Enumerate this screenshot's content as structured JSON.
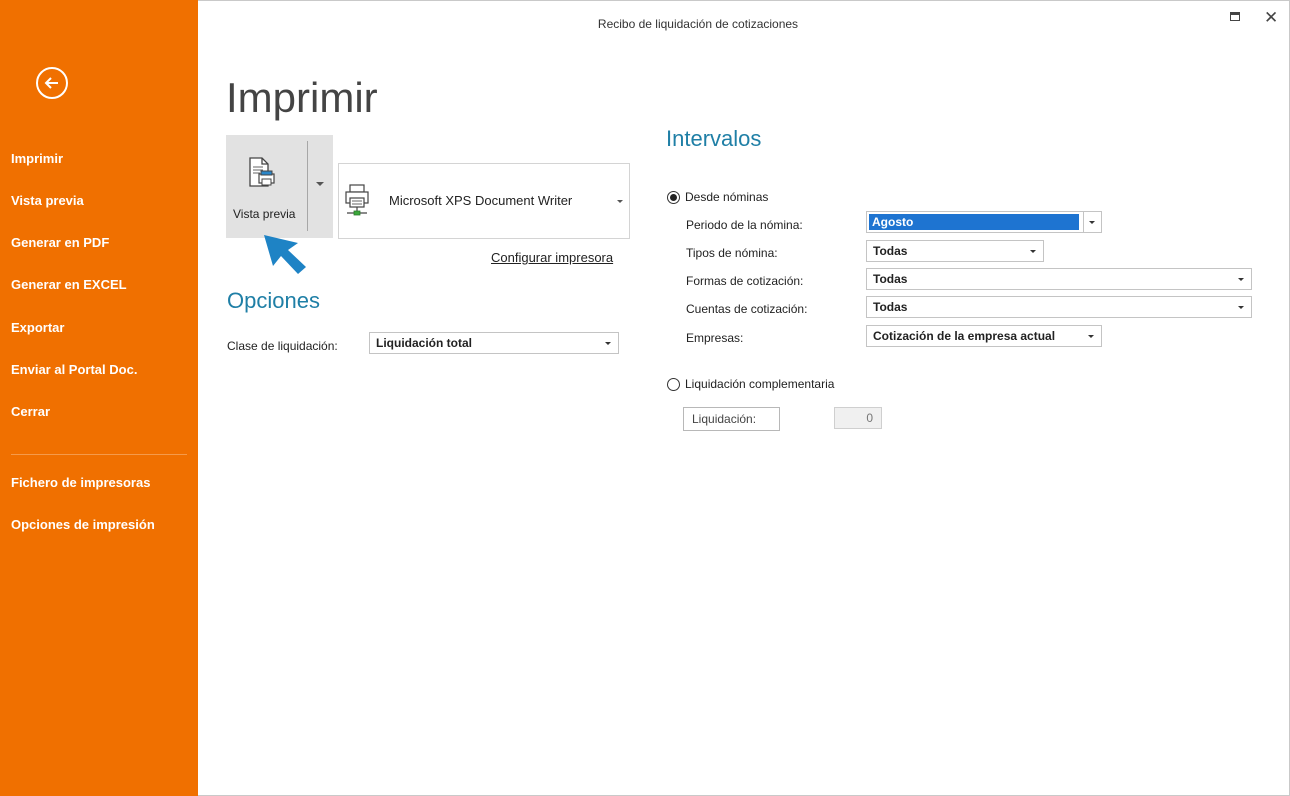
{
  "window": {
    "title": "Recibo de liquidación de cotizaciones",
    "maximize_icon": "maximize-icon",
    "close_glyph": "✕"
  },
  "sidebar": {
    "back_icon": "back-arrow-circle-icon",
    "items": [
      {
        "label": "Imprimir"
      },
      {
        "label": "Vista previa"
      },
      {
        "label": "Generar en PDF"
      },
      {
        "label": "Generar en EXCEL"
      },
      {
        "label": "Exportar"
      },
      {
        "label": "Enviar al Portal Doc."
      },
      {
        "label": "Cerrar"
      },
      {
        "label": "Fichero de impresoras"
      },
      {
        "label": "Opciones de impresión"
      }
    ],
    "color": "#f07000"
  },
  "main": {
    "title": "Imprimir",
    "preview_button": {
      "label": "Vista previa",
      "icon": "print-preview-icon"
    },
    "printer": {
      "name": "Microsoft XPS Document Writer",
      "icon": "printer-icon"
    },
    "config_link": "Configurar impresora",
    "options": {
      "heading": "Opciones",
      "clase_label": "Clase de liquidación:",
      "clase_value": "Liquidación total"
    }
  },
  "intervals": {
    "heading": "Intervalos",
    "desde_nominas": {
      "label": "Desde nóminas",
      "checked": true,
      "fields": [
        {
          "label": "Periodo de la nómina:",
          "value": "Agosto"
        },
        {
          "label": "Tipos de nómina:",
          "value": "Todas"
        },
        {
          "label": "Formas de cotización:",
          "value": "Todas"
        },
        {
          "label": "Cuentas de cotización:",
          "value": "Todas"
        },
        {
          "label": "Empresas:",
          "value": "Cotización de la empresa actual"
        }
      ]
    },
    "complementaria": {
      "label": "Liquidación complementaria",
      "checked": false,
      "button_label": "Liquidación:",
      "value": "0"
    }
  },
  "accent_color": "#1f7fa6"
}
